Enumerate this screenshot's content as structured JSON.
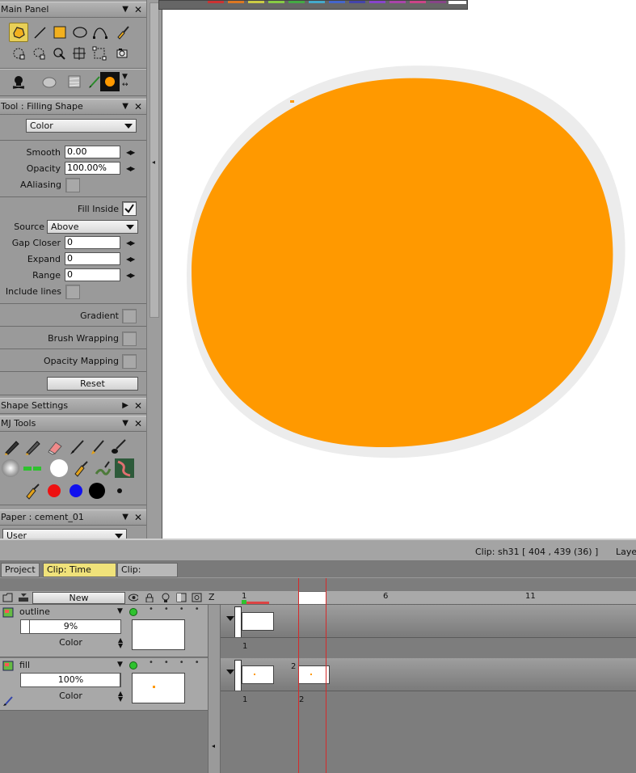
{
  "colors": {
    "fill_orange": "#ff9900",
    "tab_active": "#f0e27a",
    "tool_selected": "#e8cf57",
    "visible_green": "#2ec22e",
    "marker_red": "#d42b2b"
  },
  "main_panel": {
    "title": "Main Panel",
    "tools_row1": [
      "fill-shape-icon",
      "line-icon",
      "rectangle-icon",
      "ellipse-icon",
      "curve-icon",
      "brush-icon"
    ],
    "tools_row2": [
      "select-icon",
      "lasso-icon",
      "magic-icon",
      "transform-icon",
      "crop-icon",
      "camera-icon"
    ],
    "tools_row3": [
      "skull-icon",
      "oval-icon",
      "texture-icon",
      "pencil-icon",
      "color-swatch-icon"
    ]
  },
  "tool_panel": {
    "title": "Tool : Filling Shape",
    "mode": "Color",
    "smooth_label": "Smooth",
    "smooth_value": "0.00",
    "opacity_label": "Opacity",
    "opacity_value": "100.00%",
    "aaliasing_label": "AAliasing",
    "fill_inside_label": "Fill Inside",
    "source_label": "Source",
    "source_value": "Above",
    "gap_closer_label": "Gap Closer",
    "gap_closer_value": "0",
    "expand_label": "Expand",
    "expand_value": "0",
    "range_label": "Range",
    "range_value": "0",
    "include_lines_label": "Include lines",
    "gradient_label": "Gradient",
    "brush_wrapping_label": "Brush Wrapping",
    "opacity_mapping_label": "Opacity Mapping",
    "reset_label": "Reset"
  },
  "shape_settings": {
    "title": "Shape Settings"
  },
  "mj_tools": {
    "title": "MJ Tools"
  },
  "paper_panel": {
    "title": "Paper : cement_01",
    "value": "User"
  },
  "status": {
    "clip_info": "Clip: sh31 [ 404 , 439  (36) ]",
    "layer_label": "Laye"
  },
  "tabs": [
    {
      "label": "Project"
    },
    {
      "label": "Clip: Time Line"
    },
    {
      "label": "Clip: XSheet"
    }
  ],
  "timeline": {
    "new_label": "New",
    "z_label": "Z",
    "ruler": [
      "1",
      "6",
      "11"
    ],
    "layers": [
      {
        "name": "outline",
        "opacity": "9%",
        "opacity_fraction": 0.09,
        "mode": "Color",
        "frame_labels": [
          "1"
        ]
      },
      {
        "name": "fill",
        "opacity": "100%",
        "opacity_fraction": 1.0,
        "mode": "Color",
        "frame_labels": [
          "1",
          "2"
        ],
        "cel_label": "2"
      }
    ]
  }
}
